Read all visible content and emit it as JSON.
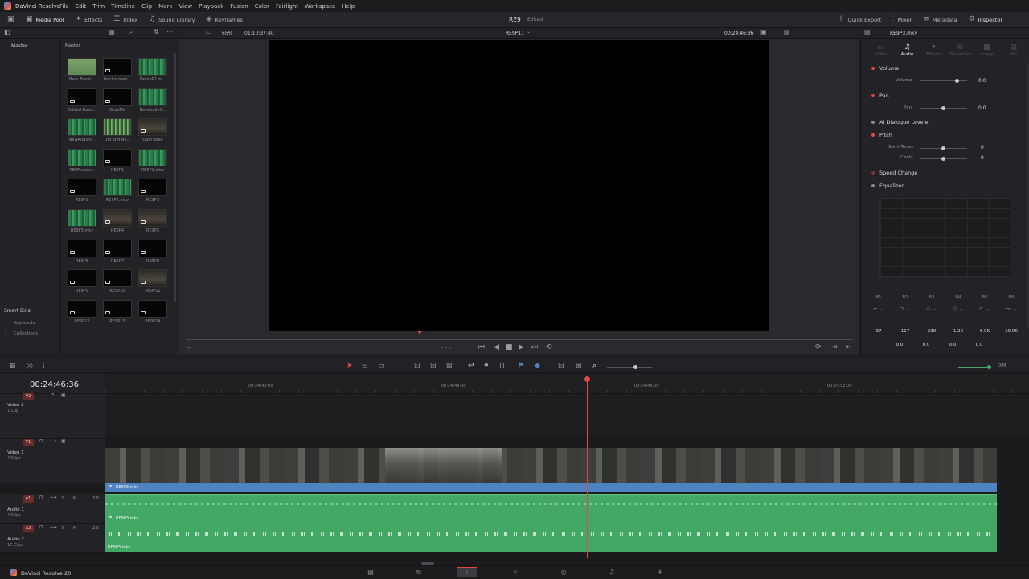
{
  "app": {
    "name": "DaVinci Resolve",
    "brand_footer": "DaVinci Resolve 20",
    "project_title": "RE9",
    "project_status": "Edited"
  },
  "menu": [
    "File",
    "Edit",
    "Trim",
    "Timeline",
    "Clip",
    "Mark",
    "View",
    "Playback",
    "Fusion",
    "Color",
    "Fairlight",
    "Workspace",
    "Help"
  ],
  "toolbar_left": [
    {
      "label": "Media Pool",
      "icon": "media-pool-icon"
    },
    {
      "label": "Effects",
      "icon": "effects-icon"
    },
    {
      "label": "Index",
      "icon": "index-icon"
    },
    {
      "label": "Sound Library",
      "icon": "sound-library-icon"
    },
    {
      "label": "Keyframes",
      "icon": "keyframes-icon"
    }
  ],
  "toolbar_right": [
    {
      "label": "Quick Export",
      "icon": "quick-export-icon"
    },
    {
      "label": "Mixer",
      "icon": "mixer-icon"
    },
    {
      "label": "Metadata",
      "icon": "metadata-icon"
    },
    {
      "label": "Inspector",
      "icon": "inspector-icon"
    }
  ],
  "viewer": {
    "zoom": "65%",
    "source_timecode": "01:10:37:40",
    "timeline_name": "RE9P11",
    "record_timecode": "00:24:46:36",
    "inspector_clip": "RE9P3.mkv"
  },
  "bins": {
    "master_label": "Master",
    "pool_header": "Master",
    "smart_bins_label": "Smart Bins",
    "smart_bins": [
      "Keywords",
      "Collections"
    ]
  },
  "clips": [
    {
      "name": "Bass Boost...",
      "style": "olive"
    },
    {
      "name": "blackscreen...",
      "style": "black"
    },
    {
      "name": "DemoP2.m...",
      "style": "green"
    },
    {
      "name": "Edited Bass...",
      "style": "black"
    },
    {
      "name": "GrabMe",
      "style": "black"
    },
    {
      "name": "NewAudioS...",
      "style": "green"
    },
    {
      "name": "NewAudioV...",
      "style": "green"
    },
    {
      "name": "Old and Ne...",
      "style": "stripes"
    },
    {
      "name": "OverTable",
      "style": "dark"
    },
    {
      "name": "RE9FinalAr...",
      "style": "green"
    },
    {
      "name": "RE9P1",
      "style": "black"
    },
    {
      "name": "RE9P1.mkv",
      "style": "green"
    },
    {
      "name": "RE9P2",
      "style": "black"
    },
    {
      "name": "RE9P2.mkv",
      "style": "green"
    },
    {
      "name": "RE9P3",
      "style": "black"
    },
    {
      "name": "RE9P3.mkv",
      "style": "green"
    },
    {
      "name": "RE9P4",
      "style": "dark"
    },
    {
      "name": "RE9P5",
      "style": "dark"
    },
    {
      "name": "RE9P6",
      "style": "black"
    },
    {
      "name": "RE9P7",
      "style": "black"
    },
    {
      "name": "RE9P8",
      "style": "black"
    },
    {
      "name": "RE9P9",
      "style": "black"
    },
    {
      "name": "RE9P10",
      "style": "black"
    },
    {
      "name": "RE9P11",
      "style": "dark"
    },
    {
      "name": "RE9P12",
      "style": "black"
    },
    {
      "name": "RE9P13",
      "style": "black"
    },
    {
      "name": "RE9P14",
      "style": "black"
    }
  ],
  "inspector": {
    "tabs": [
      "Video",
      "Audio",
      "Effects",
      "Transition",
      "Image",
      "File"
    ],
    "active_tab": "Audio",
    "volume_title": "Volume",
    "volume_label": "Volume",
    "volume_value": "0.0",
    "pan_title": "Pan",
    "pan_label": "Pan",
    "pan_value": "0.0",
    "dialogue_title": "AI Dialogue Leveler",
    "pitch_title": "Pitch",
    "semitones_label": "Semi Tones",
    "semitones_value": "0",
    "cents_label": "Cents",
    "cents_value": "0",
    "speed_title": "Speed Change",
    "eq_title": "Equalizer",
    "eq_bands": [
      "B1",
      "B2",
      "B3",
      "B4",
      "B5",
      "B6"
    ],
    "eq_freqs": [
      "97",
      "117",
      "239",
      "1.2K",
      "6.0K",
      "19.0K"
    ],
    "eq_gains": [
      "0.0",
      "0.0",
      "0.0",
      "0.0"
    ]
  },
  "timeline": {
    "timecode": "00:24:46:36",
    "ruler_marks": [
      "00:24:40:00",
      "00:24:44:00",
      "00:24:48:00",
      "00:24:52:00"
    ],
    "playhead_fraction": 0.521,
    "dim_label": "DIM",
    "tracks": {
      "v2": {
        "tag": "V2",
        "name": "Video 2",
        "sub": "1 Clip"
      },
      "v1": {
        "tag": "V1",
        "name": "Video 1",
        "sub": "4 Clips",
        "clip": "RE9P3.mkv"
      },
      "a1": {
        "tag": "A1",
        "name": "Audio 1",
        "sub": "4 Clips",
        "level": "2.0",
        "clip": "RE9P3.mkv"
      },
      "a2": {
        "tag": "A2",
        "name": "Audio 2",
        "sub": "17 Clips",
        "level": "2.0",
        "clip": "RE9P3.mkv"
      }
    }
  },
  "pages": [
    "media",
    "cut",
    "edit",
    "fusion",
    "color",
    "fairlight",
    "deliver"
  ],
  "active_page": "edit",
  "colors": {
    "accent_red": "#e04848",
    "audio_green": "#43a866",
    "video_blue": "#4d83c1",
    "panel": "#26262a"
  }
}
